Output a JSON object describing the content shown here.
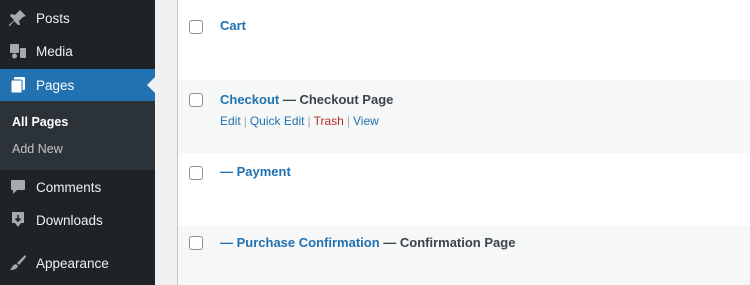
{
  "sidebar": {
    "items": [
      {
        "label": "Posts",
        "icon": "pushpin-icon"
      },
      {
        "label": "Media",
        "icon": "media-icon"
      },
      {
        "label": "Pages",
        "icon": "pages-icon",
        "active": true
      },
      {
        "label": "Comments",
        "icon": "comment-icon"
      },
      {
        "label": "Downloads",
        "icon": "download-icon"
      },
      {
        "label": "Appearance",
        "icon": "paintbrush-icon"
      }
    ],
    "submenu": {
      "current": "All Pages",
      "add_new": "Add New"
    },
    "colors": {
      "background": "#1d2327",
      "active": "#2271b1",
      "submenu": "#2c3338"
    }
  },
  "pages_table": {
    "rows": [
      {
        "title": "Cart",
        "state": ""
      },
      {
        "title": "Checkout",
        "state": " — Checkout Page",
        "actions": [
          "Edit",
          "Quick Edit",
          "Trash",
          "View"
        ]
      },
      {
        "title": "— Payment",
        "state": ""
      },
      {
        "title": "— Purchase Confirmation",
        "state": " — Confirmation Page"
      }
    ],
    "colors": {
      "link": "#2271b1",
      "trash": "#b32d2e"
    }
  }
}
